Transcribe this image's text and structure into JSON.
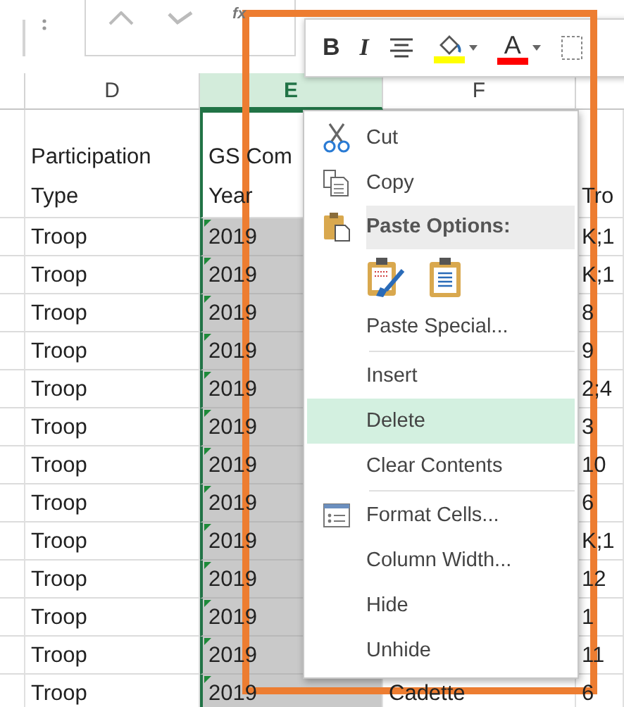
{
  "formula_bar": {
    "function_label": "fx"
  },
  "column_headers": [
    {
      "label": "D",
      "selected": false
    },
    {
      "label": "E",
      "selected": true
    },
    {
      "label": "F",
      "selected": false
    }
  ],
  "header_row": {
    "d": [
      "Participation",
      "Type"
    ],
    "e": [
      "GS Com",
      "Year"
    ],
    "g": [
      "Tro"
    ]
  },
  "rows": [
    {
      "d": "Troop",
      "e": "2019",
      "selected": true,
      "flagged": true,
      "g": "K;1"
    },
    {
      "d": "Troop",
      "e": "2019",
      "selected": true,
      "flagged": true,
      "g": "K;1"
    },
    {
      "d": "Troop",
      "e": "2019",
      "selected": true,
      "flagged": true,
      "g": "8"
    },
    {
      "d": "Troop",
      "e": "2019",
      "selected": true,
      "flagged": true,
      "g": "9"
    },
    {
      "d": "Troop",
      "e": "2019",
      "selected": true,
      "flagged": true,
      "g": "2;4"
    },
    {
      "d": "Troop",
      "e": "2019",
      "selected": true,
      "flagged": true,
      "g": "3"
    },
    {
      "d": "Troop",
      "e": "2019",
      "selected": true,
      "flagged": true,
      "g": "10"
    },
    {
      "d": "Troop",
      "e": "2019",
      "selected": true,
      "flagged": true,
      "g": "6"
    },
    {
      "d": "Troop",
      "e": "2019",
      "selected": true,
      "flagged": true,
      "g": "K;1"
    },
    {
      "d": "Troop",
      "e": "2019",
      "selected": true,
      "flagged": true,
      "g": "12"
    },
    {
      "d": "Troop",
      "e": "2019",
      "selected": true,
      "flagged": true,
      "g": "1"
    },
    {
      "d": "Troop",
      "e": "2019",
      "selected": true,
      "flagged": true,
      "g": "11"
    },
    {
      "d": "Troop",
      "e": "2019",
      "selected": true,
      "flagged": true,
      "f": "Cadette",
      "g": "6"
    }
  ],
  "mini_toolbar": [
    {
      "kind": "bold",
      "label": "B"
    },
    {
      "kind": "italic",
      "label": "I"
    },
    {
      "kind": "align"
    },
    {
      "kind": "fill",
      "color": "#ffff00"
    },
    {
      "kind": "font",
      "label": "A",
      "color": "#ff0000"
    },
    {
      "kind": "borders"
    }
  ],
  "context_menu": [
    {
      "kind": "cut",
      "label": "Cut",
      "selected": false
    },
    {
      "kind": "copy",
      "label": "Copy",
      "selected": false
    },
    {
      "kind": "header",
      "label": "Paste Options:"
    },
    {
      "kind": "paste"
    },
    {
      "kind": "command",
      "label": "Paste Special...",
      "selected": false
    },
    {
      "kind": "separator"
    },
    {
      "kind": "command",
      "label": "Insert",
      "selected": false
    },
    {
      "kind": "command",
      "label": "Delete",
      "selected": true
    },
    {
      "kind": "command",
      "label": "Clear Contents",
      "selected": false
    },
    {
      "kind": "separator"
    },
    {
      "kind": "format",
      "label": "Format Cells...",
      "selected": false
    },
    {
      "kind": "command",
      "label": "Column Width...",
      "selected": false
    },
    {
      "kind": "command",
      "label": "Hide",
      "selected": false
    },
    {
      "kind": "command",
      "label": "Unhide",
      "selected": false
    }
  ]
}
